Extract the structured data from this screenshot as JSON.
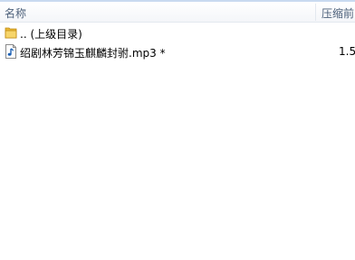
{
  "columns": {
    "name": "名称",
    "packed_size": "压缩前"
  },
  "rows": [
    {
      "name": ".. (上级目录)",
      "icon": "folder-icon",
      "size": ""
    },
    {
      "name": "绍剧林芳锦玉麒麟封驸.mp3 *",
      "icon": "audio-file-icon",
      "size": "1.5"
    }
  ]
}
